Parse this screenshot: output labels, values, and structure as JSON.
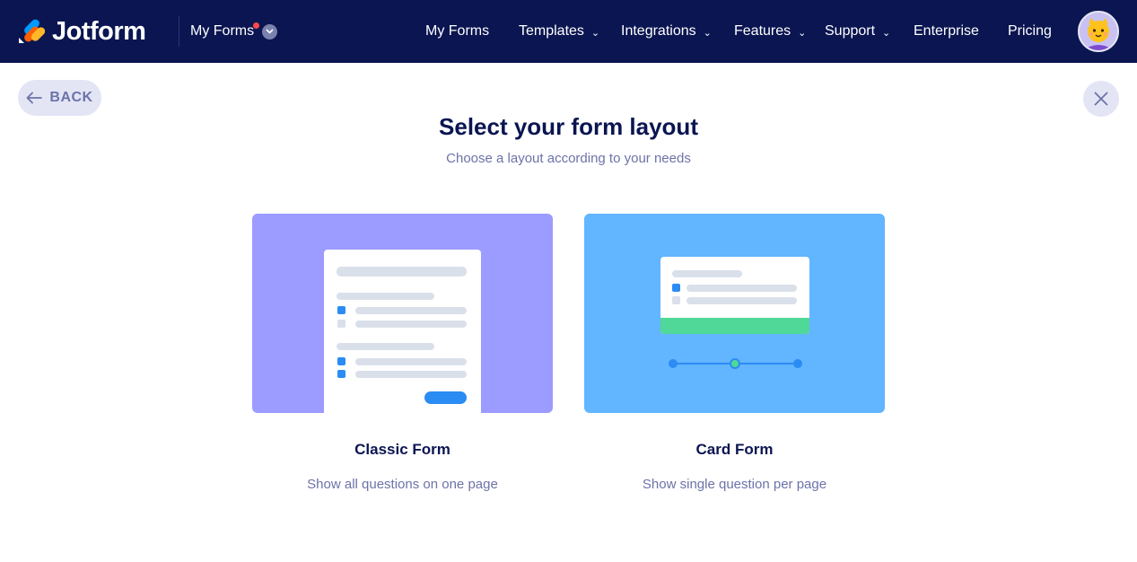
{
  "header": {
    "logo_text": "Jotform",
    "switcher_label": "My Forms",
    "nav": [
      {
        "label": "My Forms",
        "has_dropdown": false
      },
      {
        "label": "Templates",
        "has_dropdown": true
      },
      {
        "label": "Integrations",
        "has_dropdown": true
      },
      {
        "label": "Features",
        "has_dropdown": true
      },
      {
        "label": "Support",
        "has_dropdown": true
      },
      {
        "label": "Enterprise",
        "has_dropdown": false
      },
      {
        "label": "Pricing",
        "has_dropdown": false
      }
    ],
    "background": "#0a1551"
  },
  "back_button": {
    "label": "BACK",
    "icon": "arrow-left-icon"
  },
  "close_button": {
    "icon": "close-icon"
  },
  "page": {
    "title": "Select your form layout",
    "subtitle": "Choose a layout according to your needs"
  },
  "options": [
    {
      "name": "Classic Form",
      "description": "Show all questions on one page",
      "color": "#9c9bff"
    },
    {
      "name": "Card Form",
      "description": "Show single question per page",
      "color": "#62b5ff"
    }
  ],
  "colors": {
    "navy": "#0a1551",
    "muted": "#6c73a8",
    "accent_blue": "#2b8cf4",
    "accent_green": "#4fd897",
    "notification_dot": "#ff4948"
  }
}
